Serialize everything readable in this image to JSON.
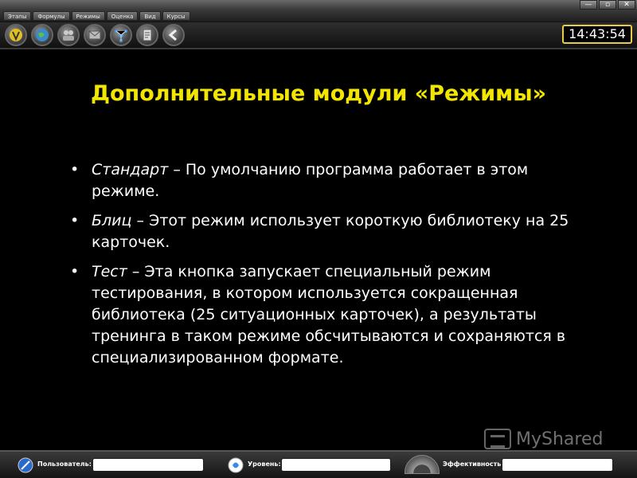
{
  "menu": {
    "items": [
      "Этапы",
      "Формулы",
      "Режимы",
      "Оценка",
      "Вид",
      "Курсы"
    ]
  },
  "window_buttons": [
    "—",
    "▫",
    "✕"
  ],
  "toolbar": {
    "buttons": [
      {
        "name": "mode-v-icon",
        "color": "#e0c020"
      },
      {
        "name": "globe-icon",
        "color": "#4aa0e0"
      },
      {
        "name": "people-icon",
        "color": "#8a8aa0"
      },
      {
        "name": "envelope-icon",
        "color": "#8a8a8a"
      },
      {
        "name": "network-icon",
        "color": "#4a9ae0"
      },
      {
        "name": "document-icon",
        "color": "#9a9a9a"
      },
      {
        "name": "back-arrow-icon",
        "color": "#d0d0d0"
      }
    ],
    "clock": "14:43:54"
  },
  "slide": {
    "title": "Дополнительные модули «Режимы»",
    "items": [
      {
        "term": "Стандарт",
        "text": " – По умолчанию программа работает в этом режиме."
      },
      {
        "term": "Блиц",
        "text": " – Этот режим использует короткую библиотеку на 25 карточек."
      },
      {
        "term": "Тест",
        "text": " – Эта кнопка запускает специальный режим тестирования, в котором используется сокращенная библиотека (25 ситуационных карточек), а результаты тренинга в таком режиме обсчитываются и сохраняются в специализированном формате."
      }
    ]
  },
  "watermark": "MyShared",
  "statusbar": {
    "user_label": "Пользователь:",
    "user_value": "",
    "level_label": "Уровень:",
    "level_value": "",
    "efficiency_label": "Эффективность:",
    "efficiency_value": ""
  },
  "colors": {
    "title": "#f2e600",
    "clock_border": "#e6cc4a"
  }
}
